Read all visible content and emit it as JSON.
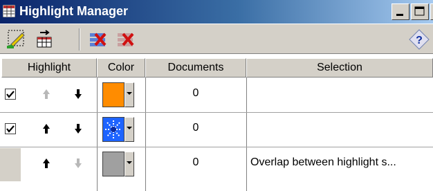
{
  "window": {
    "title": "Highlight Manager"
  },
  "toolbar": {
    "buttons": [
      "new-highlight",
      "insert-highlight",
      "delete-highlight",
      "clear-highlight"
    ],
    "help": "help"
  },
  "grid": {
    "headers": {
      "highlight": "Highlight",
      "color": "Color",
      "documents": "Documents",
      "selection": "Selection"
    },
    "rows": [
      {
        "checked": true,
        "color": "#ff8c00",
        "color_style": "solid",
        "documents": "0",
        "selection": ""
      },
      {
        "checked": true,
        "color": "#1e64ff",
        "color_style": "pattern",
        "documents": "0",
        "selection": ""
      },
      {
        "checked": false,
        "color": "#a0a0a0",
        "color_style": "solid",
        "documents": "0",
        "selection": "Overlap between highlight s..."
      }
    ]
  }
}
